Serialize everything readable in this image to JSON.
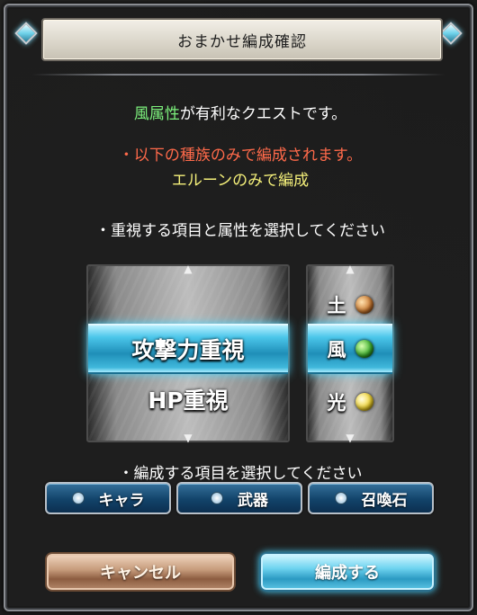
{
  "dialog": {
    "title": "おまかせ編成確認",
    "quest_element": "風属性",
    "quest_suffix": "が有利なクエストです。",
    "restriction": "・以下の種族のみで編成されます。",
    "race": "エルーンのみで編成",
    "select_focus": "・重視する項目と属性を選択してください",
    "select_items": "・編成する項目を選択してください"
  },
  "focus_picker": {
    "up_arrow": "▲",
    "down_arrow": "▼",
    "selected": "攻撃力重視",
    "next": "HP重視"
  },
  "element_picker": {
    "up_arrow": "▲",
    "down_arrow": "▼",
    "prev": "土",
    "selected": "風",
    "next": "光",
    "prev_icon": "earth-orb-icon",
    "selected_icon": "wind-orb-icon",
    "next_icon": "light-orb-icon"
  },
  "type_buttons": [
    "キャラ",
    "武器",
    "召喚石"
  ],
  "buttons": {
    "cancel": "キャンセル",
    "confirm": "編成する"
  },
  "colors": {
    "wind_text": "#7cf07c",
    "warning": "#ff6a4a",
    "race": "#f5f07a",
    "accent": "#4bc6ea"
  }
}
